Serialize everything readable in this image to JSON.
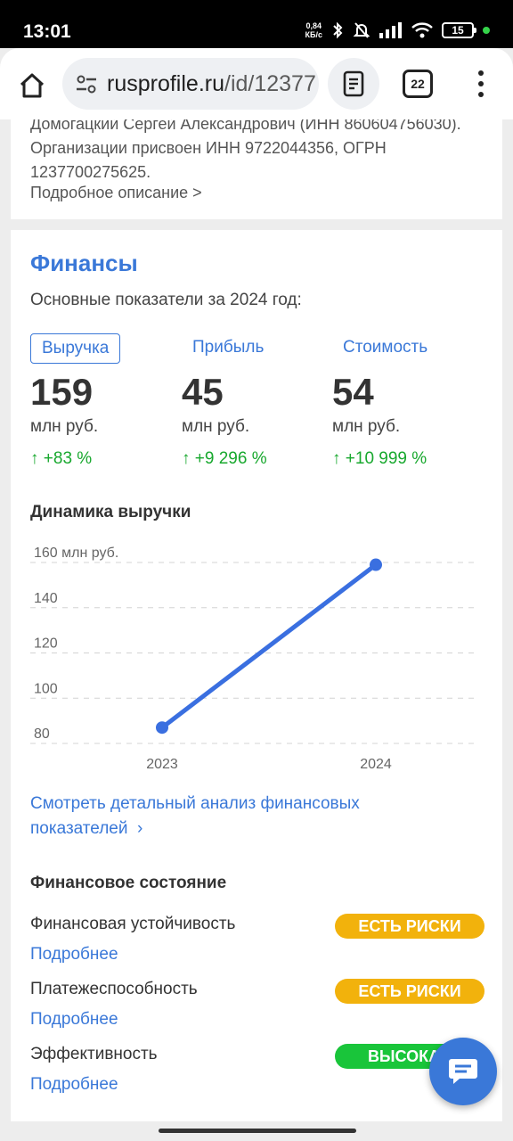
{
  "status_bar": {
    "time": "13:01",
    "speed_value": "0,84",
    "speed_unit": "КБ/с",
    "battery": "15",
    "icons": [
      "bluetooth-icon",
      "mute-icon",
      "signal-icon",
      "wifi-icon",
      "battery-icon"
    ]
  },
  "browser": {
    "url_host": "rusprofile.ru",
    "url_path": "/id/12377",
    "tab_count": "22",
    "icons": [
      "home-icon",
      "tune-icon",
      "reader-icon",
      "more-vert-icon"
    ]
  },
  "description": {
    "text": "Домогацкий Сергей Александрович (ИНН 860604756030). Организации присвоен ИНН 9722044356, ОГРН 1237700275625.",
    "more_link": "Подробное описание >"
  },
  "finance": {
    "title": "Финансы",
    "subtitle": "Основные показатели за 2024 год:",
    "metrics": [
      {
        "tab": "Выручка",
        "value": "159",
        "unit": "млн руб.",
        "delta": "↑ +83 %",
        "active": true
      },
      {
        "tab": "Прибыль",
        "value": "45",
        "unit": "млн руб.",
        "delta": "↑ +9 296 %",
        "active": false
      },
      {
        "tab": "Стоимость",
        "value": "54",
        "unit": "млн руб.",
        "delta": "↑ +10 999 %",
        "active": false
      }
    ],
    "dynamics_title": "Динамика выручки",
    "analysis_link": "Смотреть детальный анализ финансовых показателей",
    "state_title": "Финансовое состояние",
    "state_rows": [
      {
        "label": "Финансовая устойчивость",
        "link": "Подробнее",
        "badge": "ЕСТЬ РИСКИ",
        "badge_color": "#f2b20c"
      },
      {
        "label": "Платежеспособность",
        "link": "Подробнее",
        "badge": "ЕСТЬ РИСКИ",
        "badge_color": "#f2b20c"
      },
      {
        "label": "Эффективность",
        "link": "Подробнее",
        "badge": "ВЫСОКАЯ",
        "badge_color": "#19c53a"
      }
    ]
  },
  "chart_data": {
    "type": "line",
    "title": "Динамика выручки",
    "x": [
      "2023",
      "2024"
    ],
    "series": [
      {
        "values": [
          87,
          159
        ]
      }
    ],
    "ylim": [
      80,
      160
    ],
    "yticks": [
      80,
      100,
      120,
      140,
      160
    ],
    "ytick_labels": [
      "80",
      "100",
      "120",
      "140",
      "160 млн руб."
    ],
    "grid": true,
    "color": "#3a6fe0"
  },
  "colors": {
    "accent": "#3a78d8",
    "positive": "#18a82e"
  }
}
